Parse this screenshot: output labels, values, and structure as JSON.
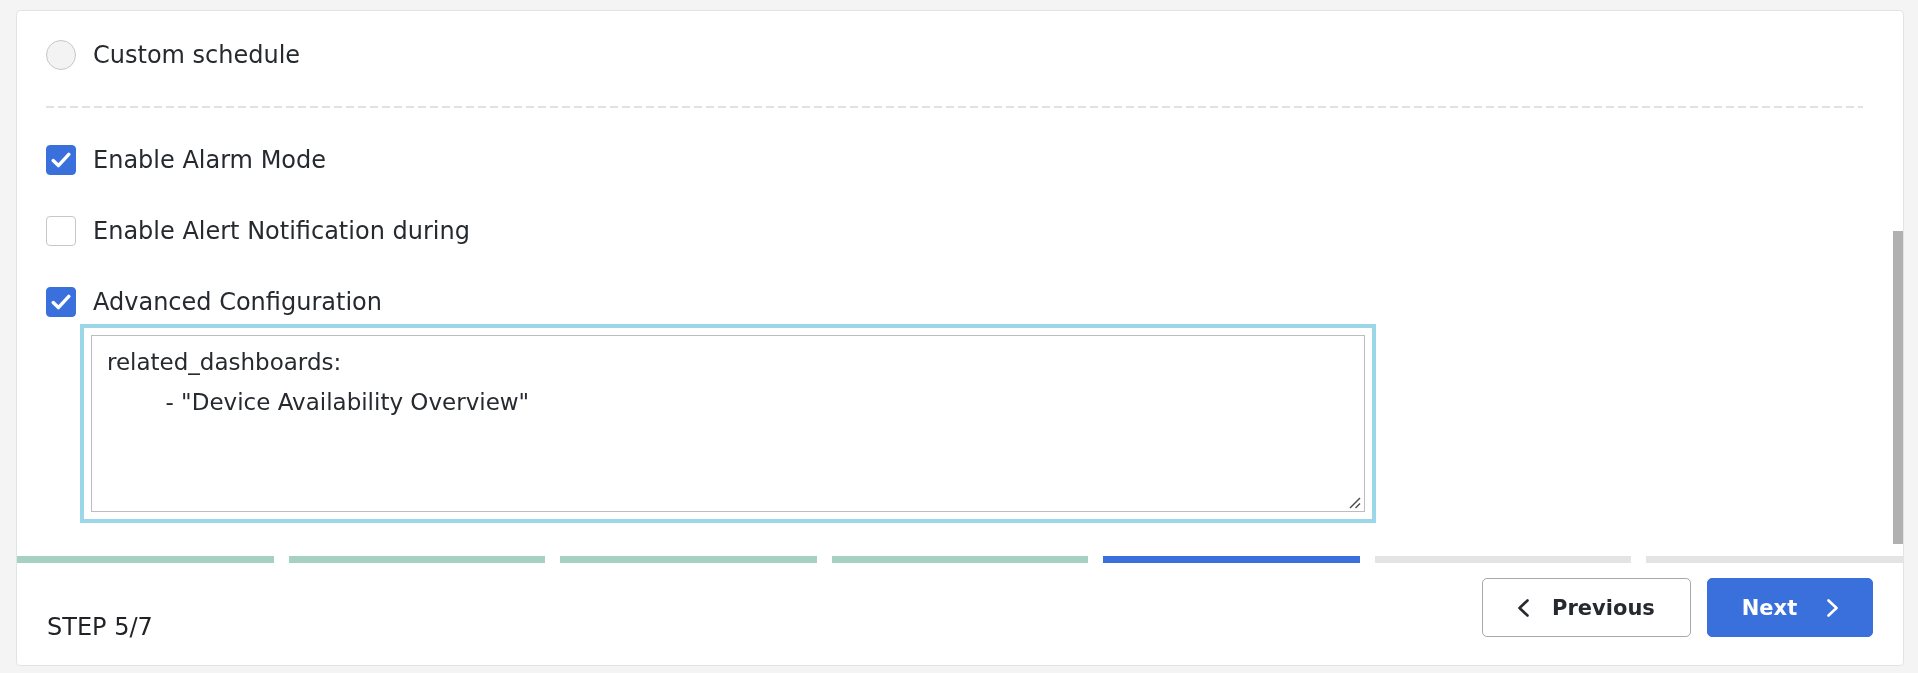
{
  "schedule_options": [
    {
      "label": "Custom schedule",
      "selected": false
    }
  ],
  "options": [
    {
      "label": "Enable Alarm Mode",
      "checked": true
    },
    {
      "label": "Enable Alert Notification during",
      "checked": false
    },
    {
      "label": "Advanced Configuration",
      "checked": true
    }
  ],
  "advanced_configuration": {
    "value": "related_dashboards:\n\t- \"Device Availability Overview\"",
    "focused": true
  },
  "progress": {
    "steps": [
      {
        "completed": true,
        "selected": false
      },
      {
        "completed": true,
        "selected": false
      },
      {
        "completed": true,
        "selected": false
      },
      {
        "completed": true,
        "selected": false
      },
      {
        "completed": false,
        "selected": true
      },
      {
        "completed": false,
        "selected": false
      },
      {
        "completed": false,
        "selected": false
      }
    ]
  },
  "footer": {
    "step_label": "STEP 5/7",
    "buttons": [
      {
        "kind": "previous",
        "label": "Previous"
      },
      {
        "kind": "next",
        "label": "Next"
      }
    ]
  }
}
